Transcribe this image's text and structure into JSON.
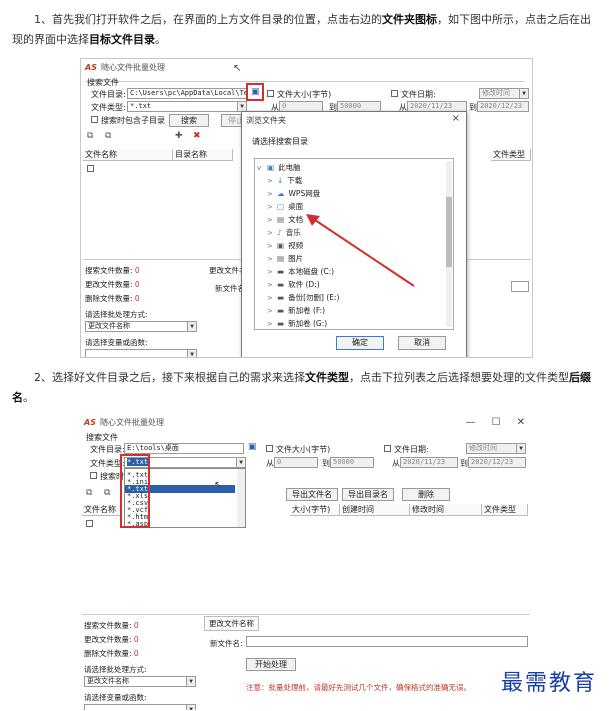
{
  "para1": {
    "a": "1、首先我们打开软件之后，在界面的上方文件目录的位置，点击右边的",
    "b1": "文件夹图标",
    "c": "，如下图中所示，点击之后在出现的界面中选择",
    "b2": "目标文件目录",
    "d": "。"
  },
  "para2": {
    "a": "2、选择好文件目录之后，接下来根据自己的需求来选择",
    "b1": "文件类型",
    "c": "，点击下拉列表之后选择想要处理的文件类型",
    "b2": "后缀名",
    "d": "。"
  },
  "app1": {
    "logo": "AS",
    "title": "随心文件批量处理",
    "group": "搜索文件",
    "dir_label": "文件目录:",
    "dir_value": "C:\\Users\\pc\\AppData\\Local\\Temp",
    "type_label": "文件类型:",
    "type_value": "*.txt",
    "subdir_label": "搜索时包含子目录",
    "search_btn": "搜索",
    "stop_btn": "停止",
    "size_label": "文件大小(字节)",
    "from": "从",
    "to": "到",
    "size_from": "0",
    "size_to": "50000",
    "date_label": "文件日期:",
    "date_mode": "修改时间",
    "date_from": "2020/11/23",
    "date_to": "2020/12/23",
    "col_name": "文件名称",
    "col_dir": "目录名称",
    "col_type": "文件类型",
    "search_count": "搜索文件数量:",
    "change_count": "更改文件数量:",
    "delete_count": "删除文件数量:",
    "count_val": "0",
    "batch_mode": "请选择批处理方式:",
    "batch_value": "更改文件名称",
    "var_label": "请选择变量或函数:",
    "tab": "更改文件名称",
    "new_name": "新文件名:"
  },
  "dialog": {
    "title": "浏览文件夹",
    "prompt": "请选择搜索目录",
    "items": [
      "此电脑",
      "下载",
      "WPS网盘",
      "桌面",
      "文档",
      "音乐",
      "视频",
      "图片",
      "本地磁盘 (C:)",
      "软件 (D:)",
      "备份[勿删] (E:)",
      "新加卷 (F:)",
      "新加卷 (G:)"
    ],
    "ok": "确定",
    "cancel": "取消"
  },
  "app2": {
    "logo": "AS",
    "title": "随心文件批量处理",
    "group": "搜索文件",
    "dir_label": "文件目录:",
    "dir_value": "E:\\tools\\桌面",
    "type_label": "文件类型:",
    "type_value": "*.txt",
    "subdir_label": "搜索时",
    "size_label": "文件大小(字节)",
    "from": "从",
    "to": "到",
    "size_from": "0",
    "size_to": "50000",
    "date_label": "文件日期:",
    "date_mode": "修改时间",
    "date_from": "2020/11/23",
    "date_to": "2020/12/23",
    "export_name": "导出文件名",
    "export_dir": "导出目录名",
    "delete_btn": "删除",
    "col_name": "文件名称",
    "col_size": "大小(字节)",
    "col_ctime": "创建时间",
    "col_mtime": "修改时间",
    "col_type": "文件类型",
    "type_options": [
      "*.txt",
      "*.ini",
      "*.txt",
      "*.xls",
      "*.csv",
      "*.vcf",
      "*.htm",
      "*.asp"
    ],
    "search_count": "搜索文件数量:",
    "change_count": "更改文件数量:",
    "delete_count": "删除文件数量:",
    "count_val": "0",
    "batch_mode": "请选择批处理方式:",
    "batch_value": "更改文件名称",
    "var_label": "请选择变量或函数:",
    "tab": "更改文件名称",
    "new_name": "新文件名:",
    "start_btn": "开始处理",
    "note": "注意：批量处理前，请最好先测试几个文件，确保格式的准确无误。"
  },
  "watermark": "最需教育",
  "colors": {
    "accent_red": "#d32f2f",
    "watermark_blue": "#1a3ea8",
    "count_red": "#c0392b"
  }
}
